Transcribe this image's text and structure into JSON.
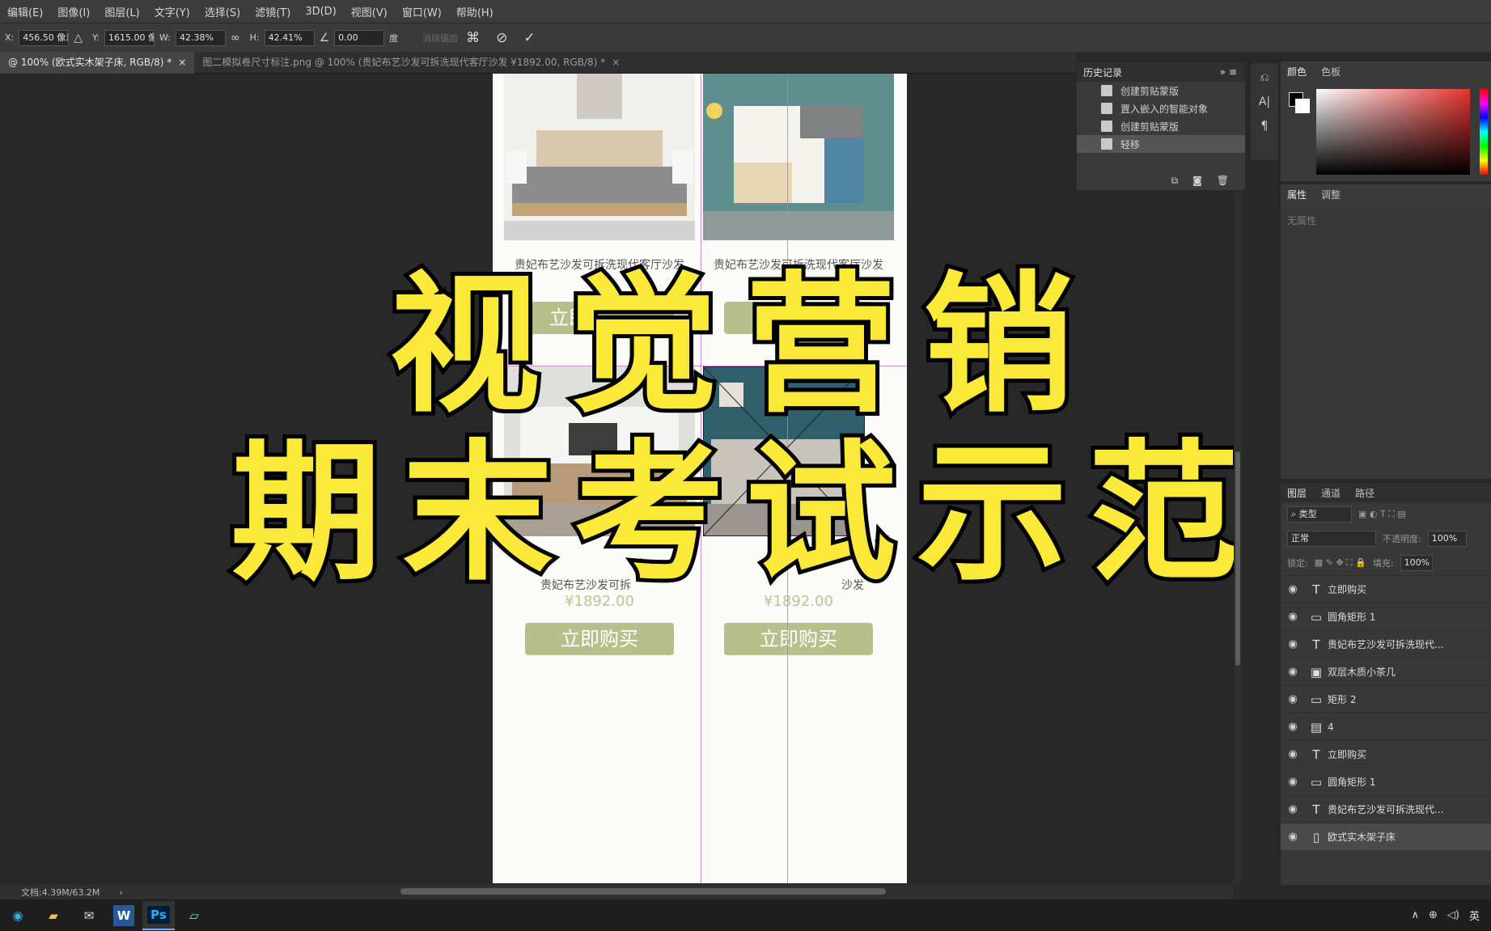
{
  "menu": [
    "编辑(E)",
    "图像(I)",
    "图层(L)",
    "文字(Y)",
    "选择(S)",
    "滤镜(T)",
    "3D(D)",
    "视图(V)",
    "窗口(W)",
    "帮助(H)"
  ],
  "options": {
    "x_label": "X:",
    "x_value": "456.50 像素",
    "y_label": "Y:",
    "y_value": "1615.00 像",
    "w_label": "W:",
    "w_value": "42.38%",
    "h_label": "H:",
    "h_value": "42.41%",
    "angle_value": "0.00",
    "angle_unit": "度",
    "cancel_warp": "消除锯齿"
  },
  "tabs": [
    {
      "label": "@ 100% (欧式实木架子床, RGB/8) *",
      "close": "×"
    },
    {
      "label": "图二模拟卷尺寸标注.png @ 100% (贵妃布艺沙发可拆洗现代客厅沙发  ¥1892.00, RGB/8) *",
      "close": "×"
    }
  ],
  "products": {
    "name": "贵妃布艺沙发可拆洗现代客厅沙发",
    "name_trunc_left": "贵妃布艺沙发可拆",
    "name_trunc_right_a": "贵妃布",
    "name_trunc_right_b": "洗现",
    "name_trunc_right_c": "沙发",
    "price": "¥1892.00",
    "price_partial": "¥1",
    "button": "立即购买",
    "button_partial": "立即"
  },
  "overlay": {
    "line1": "视觉营销",
    "line2": "期末考试示范"
  },
  "history": {
    "title": "历史记录",
    "items": [
      "创建剪贴蒙版",
      "置入嵌入的智能对象",
      "创建剪贴蒙版",
      "轻移"
    ]
  },
  "color_panel": {
    "tab_color": "颜色",
    "tab_swatches": "色板"
  },
  "properties": {
    "tab_props": "属性",
    "tab_adjust": "调整",
    "empty": "无属性"
  },
  "layers_panel": {
    "tab_layers": "图层",
    "tab_channels": "通道",
    "tab_paths": "路径",
    "kind": "类型",
    "blend": "正常",
    "opacity_label": "不透明度:",
    "opacity": "100%",
    "lock_label": "锁定:",
    "fill_label": "填充:",
    "fill": "100%",
    "layers": [
      {
        "name": "立即购买",
        "icon": "T"
      },
      {
        "name": "圆角矩形 1",
        "icon": "▭"
      },
      {
        "name": "贵妃布艺沙发可拆洗现代...",
        "icon": "T"
      },
      {
        "name": "双层木质小茶几",
        "icon": "▣"
      },
      {
        "name": "矩形 2",
        "icon": "▭"
      },
      {
        "name": "4",
        "icon": "▤"
      },
      {
        "name": "立即购买",
        "icon": "T"
      },
      {
        "name": "圆角矩形 1",
        "icon": "▭"
      },
      {
        "name": "贵妃布艺沙发可拆洗现代...",
        "icon": "T"
      },
      {
        "name": "欧式实木架子床",
        "icon": "▯"
      }
    ]
  },
  "status": {
    "doc": "文档:4.39M/63.2M",
    "arrow": "›"
  },
  "taskbar": {
    "ime": "英",
    "ps": "Ps",
    "word": "W"
  },
  "colors": {
    "accent_button": "#b7c08d",
    "overlay_yellow": "#fbe93a",
    "price": "#b9c595"
  }
}
